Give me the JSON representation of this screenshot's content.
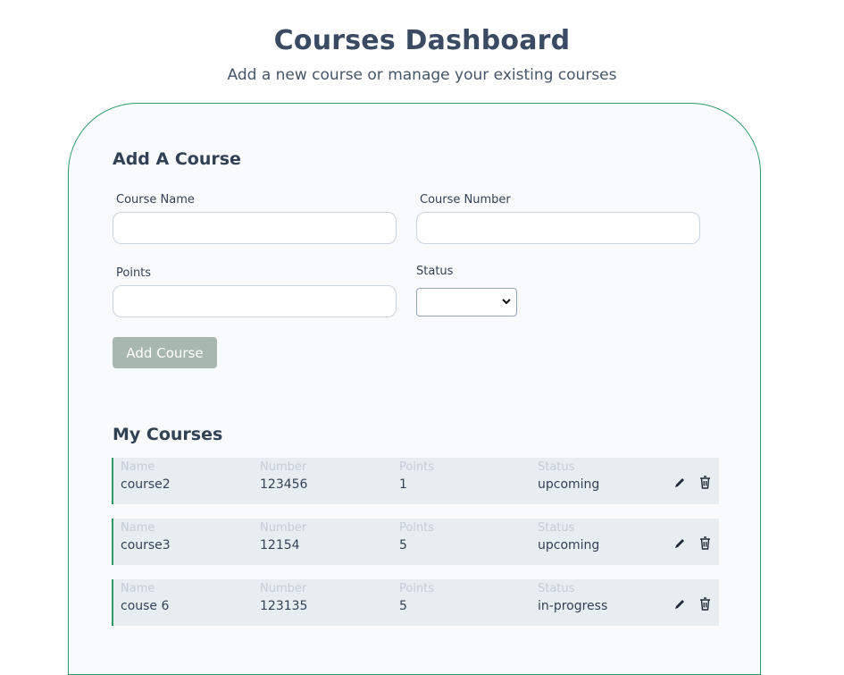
{
  "header": {
    "title": "Courses Dashboard",
    "subtitle": "Add a new course or manage your existing courses"
  },
  "add_form": {
    "title": "Add A Course",
    "course_name_label": "Course Name",
    "course_name_value": "",
    "course_number_label": "Course Number",
    "course_number_value": "",
    "points_label": "Points",
    "points_value": "",
    "status_label": "Status",
    "status_value": "",
    "submit_label": "Add Course"
  },
  "courses": {
    "title": "My Courses",
    "columns": {
      "name": "Name",
      "number": "Number",
      "points": "Points",
      "status": "Status"
    },
    "rows": [
      {
        "name": "course2",
        "number": "123456",
        "points": "1",
        "status": "upcoming"
      },
      {
        "name": "course3",
        "number": "12154",
        "points": "5",
        "status": "upcoming"
      },
      {
        "name": "couse 6",
        "number": "123135",
        "points": "5",
        "status": "in-progress"
      }
    ],
    "row_icons": [
      "edit-icon",
      "trash-icon"
    ]
  },
  "colors": {
    "accent": "#2e9a6a",
    "button_disabled": "#a8b8b0",
    "row_background": "#e8edf1",
    "card_background": "#f8fafc"
  }
}
